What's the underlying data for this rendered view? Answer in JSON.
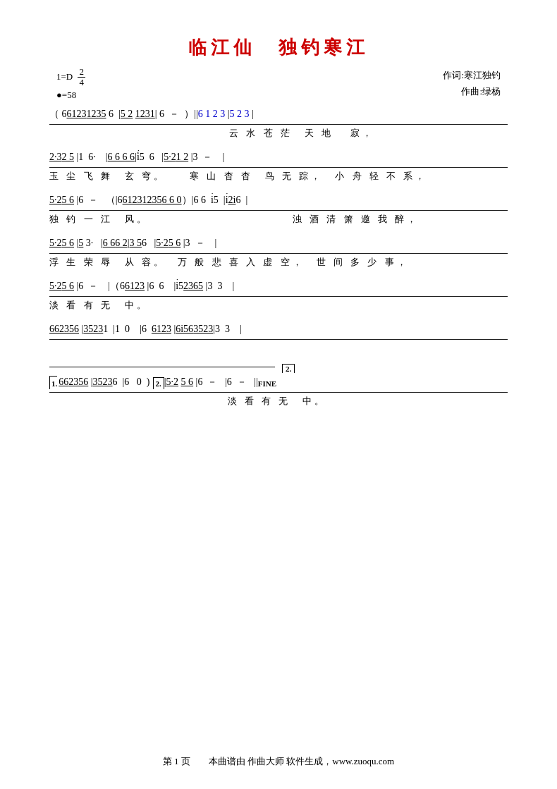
{
  "title": {
    "main": "临江仙　独钓寒江"
  },
  "header": {
    "tempo_label": "1=D",
    "meter_num": "2",
    "meter_den": "4",
    "beat": "●=58",
    "author1": "作词:寒江独钓",
    "author2": "作曲:绿杨"
  },
  "footer": {
    "page": "第 1 页",
    "software": "本曲谱由 作曲大师 软件生成，www.zuoqu.com"
  }
}
